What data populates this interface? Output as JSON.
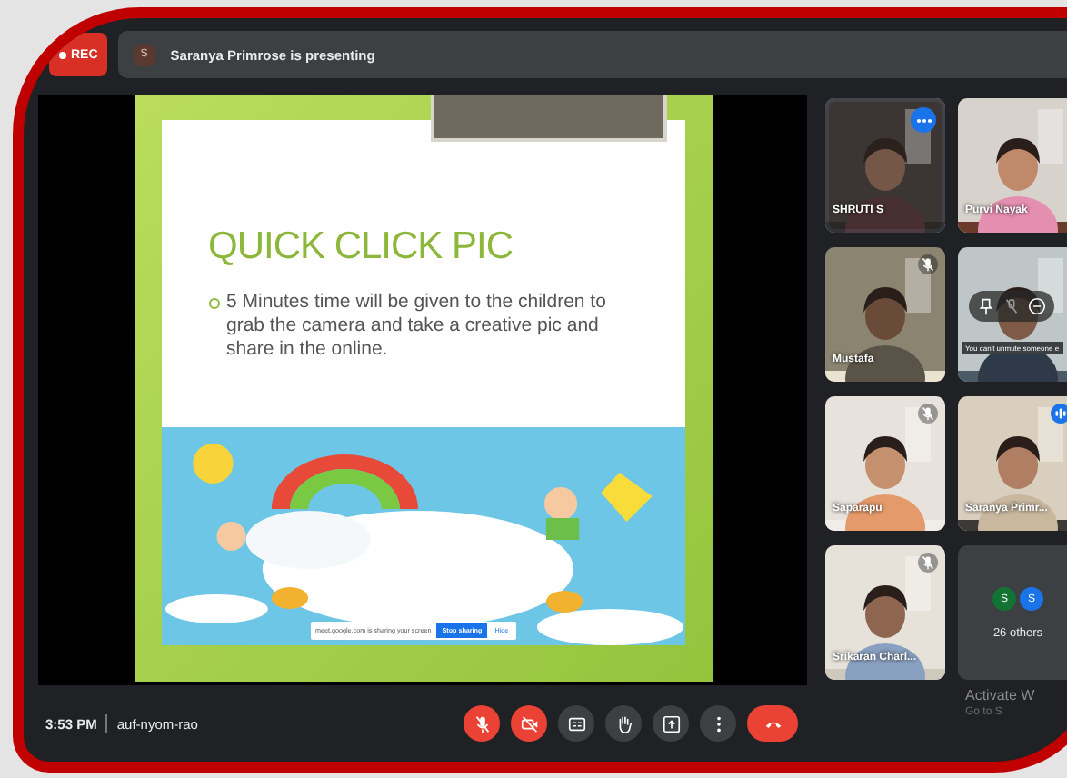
{
  "recording": {
    "label": "REC"
  },
  "presenter_banner": {
    "avatar": "S",
    "text": "Saranya Primrose is presenting"
  },
  "slide": {
    "title": "QUICK CLICK PIC",
    "bullets": [
      "5 Minutes time will be given to the children to grab the camera and take a creative pic and share in the online."
    ],
    "image": {
      "kind": "picture"
    },
    "share_bar": {
      "message": "meet.google.com is sharing your screen",
      "stop": "Stop sharing",
      "hide": "Hide"
    }
  },
  "participants": [
    {
      "kind": "video",
      "name": "SHRUTI S",
      "selected": true,
      "hovered": false,
      "muted": false,
      "speaking": false
    },
    {
      "kind": "video",
      "name": "Purvi Nayak",
      "selected": false,
      "hovered": false,
      "muted": false,
      "speaking": false
    },
    {
      "kind": "video",
      "name": "Mustafa",
      "selected": false,
      "hovered": false,
      "muted": true,
      "speaking": false
    },
    {
      "kind": "video",
      "selected": false,
      "hovered": true,
      "muted": false,
      "speaking": false,
      "tooltip": "You can't unmute someone e"
    },
    {
      "kind": "video",
      "name": "Saparapu",
      "selected": false,
      "hovered": false,
      "muted": true,
      "speaking": false
    },
    {
      "kind": "video",
      "name": "Saranya Primr...",
      "selected": false,
      "hovered": false,
      "muted": false,
      "speaking": true
    },
    {
      "kind": "video",
      "name": "Srikaran Charl...",
      "selected": false,
      "hovered": false,
      "muted": true,
      "speaking": false
    },
    {
      "kind": "others",
      "label": "26 others",
      "avatars": [
        {
          "letter": "S",
          "color": "#137333"
        },
        {
          "letter": "S",
          "color": "#1a73e8"
        }
      ]
    }
  ],
  "bottom_bar": {
    "time": "3:53 PM",
    "meeting_code": "auf-nyom-rao",
    "controls": [
      {
        "kind": "mic",
        "on": false
      },
      {
        "kind": "camera",
        "on": false
      },
      {
        "kind": "captions",
        "on": false
      },
      {
        "kind": "hand"
      },
      {
        "kind": "present"
      },
      {
        "kind": "more"
      },
      {
        "kind": "leave"
      }
    ]
  },
  "os_notice": {
    "title": "Activate W",
    "subtitle": "Go to S"
  }
}
